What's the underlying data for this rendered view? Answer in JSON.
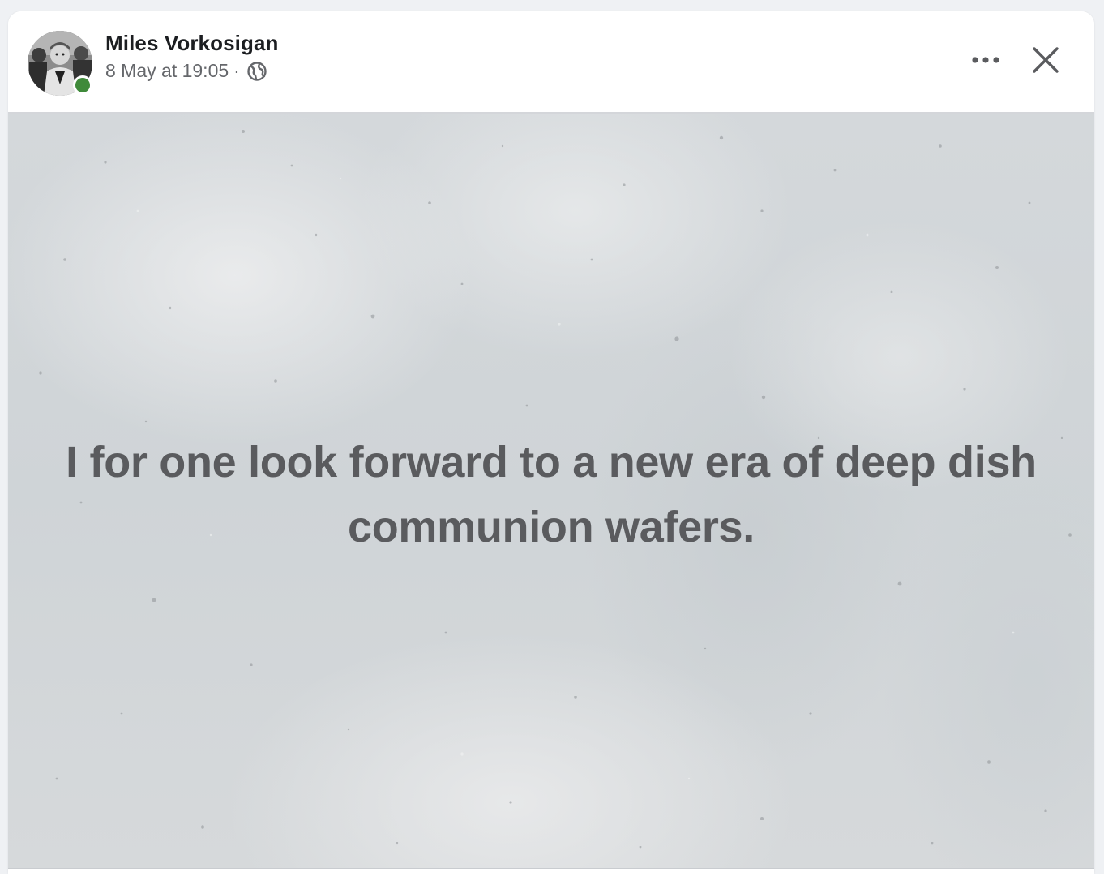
{
  "post": {
    "author": "Miles Vorkosigan",
    "timestamp": "8 May at 19:05",
    "separator": "·",
    "audience_icon": "globe-icon",
    "status": "online",
    "body_text": "I for one look forward to a new era of deep dish communion wafers."
  },
  "header": {
    "more_icon": "more-options-icon",
    "close_icon": "close-icon"
  },
  "colors": {
    "online_dot": "#3f8a3a",
    "author_text": "#1c1e21",
    "meta_text": "#65676b",
    "post_text": "#5a5b5e",
    "background_texture": "#d2d6d9"
  }
}
